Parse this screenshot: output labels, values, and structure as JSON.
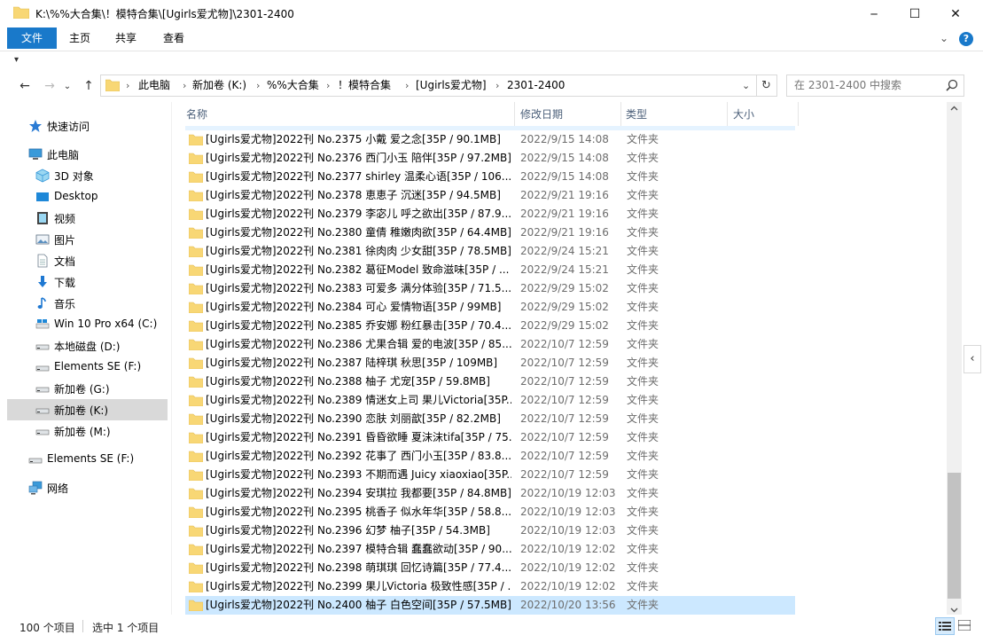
{
  "window": {
    "title": "K:\\%%大合集\\！模特合集\\[Ugirls爱尤物]\\2301-2400",
    "minimize_glyph": "─",
    "maximize_glyph": "☐",
    "close_glyph": "✕"
  },
  "ribbon": {
    "tabs": [
      "文件",
      "主页",
      "共享",
      "查看"
    ],
    "expand_glyph": "⌄",
    "help_glyph": "?"
  },
  "qa": {
    "dropdown_glyph": "▾"
  },
  "nav": {
    "back_glyph": "←",
    "forward_glyph": "→",
    "dropdown_glyph": "⌄",
    "up_glyph": "↑",
    "breadcrumbs": [
      "此电脑",
      "新加卷 (K:)",
      "%%大合集",
      "！模特合集",
      "[Ugirls爱尤物]",
      "2301-2400"
    ],
    "sep_glyph": "›",
    "addr_dropdown_glyph": "⌄",
    "refresh_glyph": "↻",
    "search_placeholder": "在 2301-2400 中搜索"
  },
  "sidebar": {
    "items": [
      {
        "label": "快速访问",
        "icon": "star-icon"
      },
      {
        "label": "此电脑",
        "icon": "computer-icon"
      },
      {
        "label": "3D 对象",
        "icon": "cube-icon"
      },
      {
        "label": "Desktop",
        "icon": "desktop-icon"
      },
      {
        "label": "视频",
        "icon": "video-icon"
      },
      {
        "label": "图片",
        "icon": "picture-icon"
      },
      {
        "label": "文档",
        "icon": "document-icon"
      },
      {
        "label": "下载",
        "icon": "download-icon"
      },
      {
        "label": "音乐",
        "icon": "music-icon"
      },
      {
        "label": "Win 10 Pro x64 (C:)",
        "icon": "drive-c-icon"
      },
      {
        "label": "本地磁盘 (D:)",
        "icon": "drive-icon"
      },
      {
        "label": "Elements SE (F:)",
        "icon": "drive-icon"
      },
      {
        "label": "新加卷 (G:)",
        "icon": "drive-icon"
      },
      {
        "label": "新加卷 (K:)",
        "icon": "drive-icon"
      },
      {
        "label": "新加卷 (M:)",
        "icon": "drive-icon"
      },
      {
        "label": "Elements SE (F:)",
        "icon": "drive-icon"
      },
      {
        "label": "网络",
        "icon": "network-icon"
      }
    ]
  },
  "columns": {
    "name": "名称",
    "date": "修改日期",
    "type": "类型",
    "size": "大小",
    "sort_glyph": "^"
  },
  "files": [
    {
      "name": "[Ugirls爱尤物]2022刊 No.2375 小戴 爱之念[35P / 90.1MB]",
      "date": "2022/9/15 14:08",
      "type": "文件夹"
    },
    {
      "name": "[Ugirls爱尤物]2022刊 No.2376 西门小玉 陪伴[35P / 97.2MB]",
      "date": "2022/9/15 14:08",
      "type": "文件夹"
    },
    {
      "name": "[Ugirls爱尤物]2022刊 No.2377 shirley 温柔心语[35P / 106...",
      "date": "2022/9/15 14:08",
      "type": "文件夹"
    },
    {
      "name": "[Ugirls爱尤物]2022刊 No.2378 恵恵子 沉迷[35P / 94.5MB]",
      "date": "2022/9/21 19:16",
      "type": "文件夹"
    },
    {
      "name": "[Ugirls爱尤物]2022刊 No.2379 李宓儿 呼之欲出[35P / 87.9...",
      "date": "2022/9/21 19:16",
      "type": "文件夹"
    },
    {
      "name": "[Ugirls爱尤物]2022刊 No.2380 童倩 稚嫩肉欲[35P / 64.4MB]",
      "date": "2022/9/21 19:16",
      "type": "文件夹"
    },
    {
      "name": "[Ugirls爱尤物]2022刊 No.2381 徐肉肉 少女甜[35P / 78.5MB]",
      "date": "2022/9/24 15:21",
      "type": "文件夹"
    },
    {
      "name": "[Ugirls爱尤物]2022刊 No.2382 葛征Model 致命滋味[35P / ...",
      "date": "2022/9/24 15:21",
      "type": "文件夹"
    },
    {
      "name": "[Ugirls爱尤物]2022刊 No.2383 可爱多 满分体验[35P / 71.5...",
      "date": "2022/9/29 15:02",
      "type": "文件夹"
    },
    {
      "name": "[Ugirls爱尤物]2022刊 No.2384 可心 爱情物语[35P / 99MB]",
      "date": "2022/9/29 15:02",
      "type": "文件夹"
    },
    {
      "name": "[Ugirls爱尤物]2022刊 No.2385 乔安娜 粉红暴击[35P / 70.4...",
      "date": "2022/9/29 15:02",
      "type": "文件夹"
    },
    {
      "name": "[Ugirls爱尤物]2022刊 No.2386 尤果合辑 爱的电波[35P / 85....",
      "date": "2022/10/7 12:59",
      "type": "文件夹"
    },
    {
      "name": "[Ugirls爱尤物]2022刊 No.2387 陆梓琪 秋思[35P / 109MB]",
      "date": "2022/10/7 12:59",
      "type": "文件夹"
    },
    {
      "name": "[Ugirls爱尤物]2022刊 No.2388 柚子 尤宠[35P / 59.8MB]",
      "date": "2022/10/7 12:59",
      "type": "文件夹"
    },
    {
      "name": "[Ugirls爱尤物]2022刊 No.2389 情迷女上司 果儿Victoria[35P...",
      "date": "2022/10/7 12:59",
      "type": "文件夹"
    },
    {
      "name": "[Ugirls爱尤物]2022刊 No.2390 恋肤 刘丽歆[35P / 82.2MB]",
      "date": "2022/10/7 12:59",
      "type": "文件夹"
    },
    {
      "name": "[Ugirls爱尤物]2022刊 No.2391 昏昏欲睡 夏沫沫tifa[35P / 75...",
      "date": "2022/10/7 12:59",
      "type": "文件夹"
    },
    {
      "name": "[Ugirls爱尤物]2022刊 No.2392 花事了 西门小玉[35P / 83.8...",
      "date": "2022/10/7 12:59",
      "type": "文件夹"
    },
    {
      "name": "[Ugirls爱尤物]2022刊 No.2393 不期而遇 Juicy xiaoxiao[35P...",
      "date": "2022/10/7 12:59",
      "type": "文件夹"
    },
    {
      "name": "[Ugirls爱尤物]2022刊 No.2394 安琪拉 我都要[35P / 84.8MB]",
      "date": "2022/10/19 12:03",
      "type": "文件夹"
    },
    {
      "name": "[Ugirls爱尤物]2022刊 No.2395 桃香子 似水年华[35P / 58.8...",
      "date": "2022/10/19 12:03",
      "type": "文件夹"
    },
    {
      "name": "[Ugirls爱尤物]2022刊 No.2396 幻梦 柚子[35P / 54.3MB]",
      "date": "2022/10/19 12:03",
      "type": "文件夹"
    },
    {
      "name": "[Ugirls爱尤物]2022刊 No.2397 模特合辑 蠢蠢欲动[35P / 90....",
      "date": "2022/10/19 12:02",
      "type": "文件夹"
    },
    {
      "name": "[Ugirls爱尤物]2022刊 No.2398 萌琪琪 回忆诗篇[35P / 77.4...",
      "date": "2022/10/19 12:02",
      "type": "文件夹"
    },
    {
      "name": "[Ugirls爱尤物]2022刊 No.2399 果儿Victoria 极致性感[35P / ...",
      "date": "2022/10/19 12:02",
      "type": "文件夹"
    },
    {
      "name": "[Ugirls爱尤物]2022刊 No.2400 柚子 白色空间[35P / 57.5MB]",
      "date": "2022/10/20 13:56",
      "type": "文件夹"
    }
  ],
  "status": {
    "count": "100 个项目",
    "selected": "选中 1 个项目"
  },
  "side_toggle_glyph": "‹",
  "colors": {
    "accent": "#1979ca",
    "selection": "#cce8ff",
    "folder": "#f8d775",
    "header_text": "#4c607a"
  }
}
